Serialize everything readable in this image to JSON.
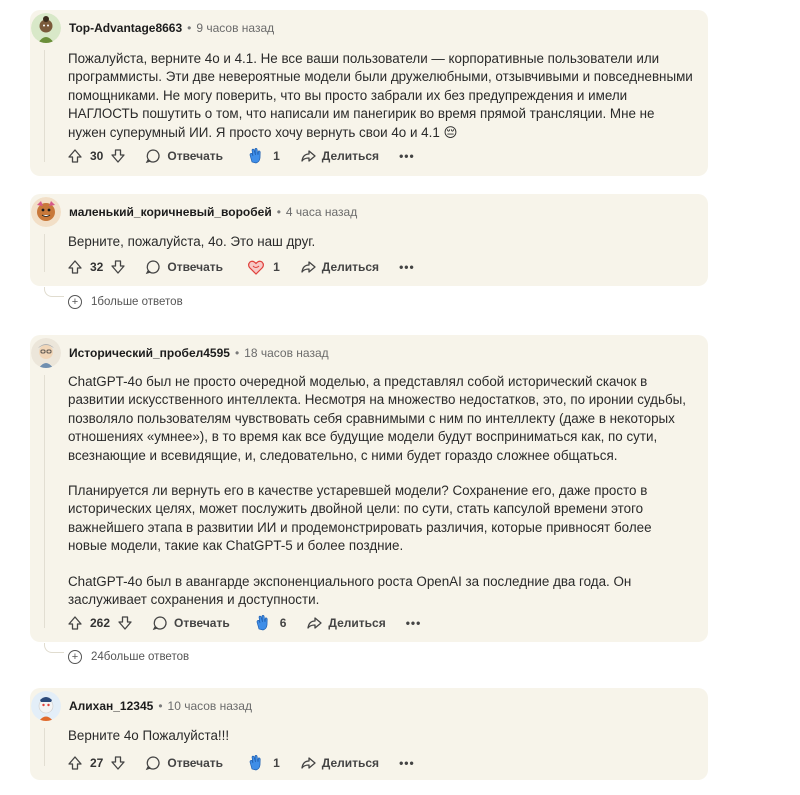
{
  "comments": [
    {
      "author": "Top-Advantage8663",
      "time": "9 часов назад",
      "paragraphs": [
        "Пожалуйста, верните 4о и 4.1. Не все ваши пользователи — корпоративные пользователи или программисты. Эти две невероятные модели были дружелюбными, отзывчивыми и повседневными помощниками. Не могу поверить, что вы просто забрали их без предупреждения и имели НАГЛОСТЬ пошутить о том, что написали им панегирик во время прямой трансляции. Мне не нужен суперумный ИИ. Я просто хочу вернуть свои 4о и 4.1 😔"
      ],
      "votes": "30",
      "reply_label": "Отвечать",
      "award_count": "1",
      "share_label": "Делиться",
      "more_label": "•••"
    },
    {
      "author": "маленький_коричневый_воробей",
      "time": "4 часа назад",
      "paragraphs": [
        "Верните, пожалуйста, 4о. Это наш друг."
      ],
      "votes": "32",
      "reply_label": "Отвечать",
      "award_count": "1",
      "share_label": "Делиться",
      "more_label": "•••",
      "more_replies": "1больше ответов"
    },
    {
      "author": "Исторический_пробел4595",
      "time": "18 часов назад",
      "paragraphs": [
        "ChatGPT-4o был не просто очередной моделью, а представлял собой исторический скачок в развитии искусственного интеллекта. Несмотря на множество недостатков, это, по иронии судьбы, позволяло пользователям чувствовать себя сравнимыми с ним по интеллекту (даже в некоторых отношениях «умнее»), в то время как все будущие модели будут восприниматься как, по сути, всезнающие и всевидящие, и, следовательно, с ними будет гораздо сложнее общаться.",
        "Планируется ли вернуть его в качестве устаревшей модели? Сохранение его, даже просто в исторических целях, может послужить двойной цели: по сути, стать капсулой времени этого важнейшего этапа в развитии ИИ и продемонстрировать различия, которые привносят более новые модели, такие как ChatGPT-5 и более поздние.",
        "ChatGPT-4o был в авангарде экспоненциального роста OpenAI за последние два года. Он заслуживает сохранения и доступности."
      ],
      "votes": "262",
      "reply_label": "Отвечать",
      "award_count": "6",
      "share_label": "Делиться",
      "more_label": "•••",
      "more_replies": "24больше ответов"
    },
    {
      "author": "Алихан_12345",
      "time": "10 часов назад",
      "paragraphs": [
        "Верните 4о Пожалуйста!!!"
      ],
      "votes": "27",
      "reply_label": "Отвечать",
      "award_count": "1",
      "share_label": "Делиться",
      "more_label": "•••"
    }
  ],
  "meta": {
    "separator": "•",
    "plus": "+"
  },
  "colors": {
    "card_bg": "#f7f4ea",
    "award_blue": "#3f8ee8",
    "heart_red": "#e0413c"
  }
}
